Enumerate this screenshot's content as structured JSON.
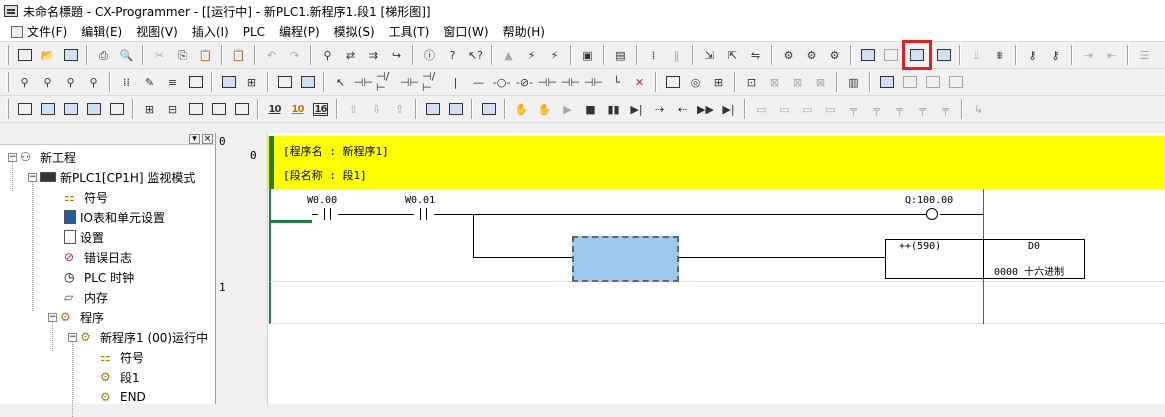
{
  "window": {
    "title": "未命名標題 - CX-Programmer - [[运行中] - 新PLC1.新程序1.段1 [梯形图]]"
  },
  "menu": [
    {
      "label": "文件(F)",
      "icon": "page-icon"
    },
    {
      "label": "编辑(E)"
    },
    {
      "label": "视图(V)"
    },
    {
      "label": "插入(I)"
    },
    {
      "label": "PLC"
    },
    {
      "label": "编程(P)"
    },
    {
      "label": "模拟(S)"
    },
    {
      "label": "工具(T)"
    },
    {
      "label": "窗口(W)"
    },
    {
      "label": "帮助(H)"
    }
  ],
  "toolbar": {
    "highlighted_button": "monitor-online-edit-icon",
    "num_buttons": [
      "10",
      "10",
      "16"
    ]
  },
  "sidebar": {
    "tree": [
      {
        "label": "新工程",
        "icon": "project-icon",
        "expander": "−"
      },
      {
        "label": "新PLC1[CP1H] 监视模式",
        "icon": "plc-icon",
        "expander": "−"
      },
      {
        "label": "符号",
        "icon": "symbols-icon"
      },
      {
        "label": "IO表和单元设置",
        "icon": "io-table-icon"
      },
      {
        "label": "设置",
        "icon": "settings-icon"
      },
      {
        "label": "错误日志",
        "icon": "error-log-icon"
      },
      {
        "label": "PLC 时钟",
        "icon": "clock-icon"
      },
      {
        "label": "内存",
        "icon": "memory-icon"
      },
      {
        "label": "程序",
        "icon": "programs-icon",
        "expander": "−"
      },
      {
        "label": "新程序1 (00)运行中",
        "icon": "program-icon",
        "expander": "−"
      },
      {
        "label": "符号",
        "icon": "local-symbols-icon"
      },
      {
        "label": "段1",
        "icon": "section-icon"
      },
      {
        "label": "END",
        "icon": "end-section-icon"
      }
    ]
  },
  "ladder": {
    "rung0_number": "0",
    "rung0_step": "0",
    "rung1_number": "1",
    "program_name": "[程序名 : 新程序1]",
    "section_name": "[段名称 : 段1]",
    "contact1": "W0.00",
    "contact2": "W0.01",
    "coil": "Q:100.00",
    "instruction": "++(590)",
    "operand": "D0",
    "operand_value": "0000 十六进制"
  }
}
